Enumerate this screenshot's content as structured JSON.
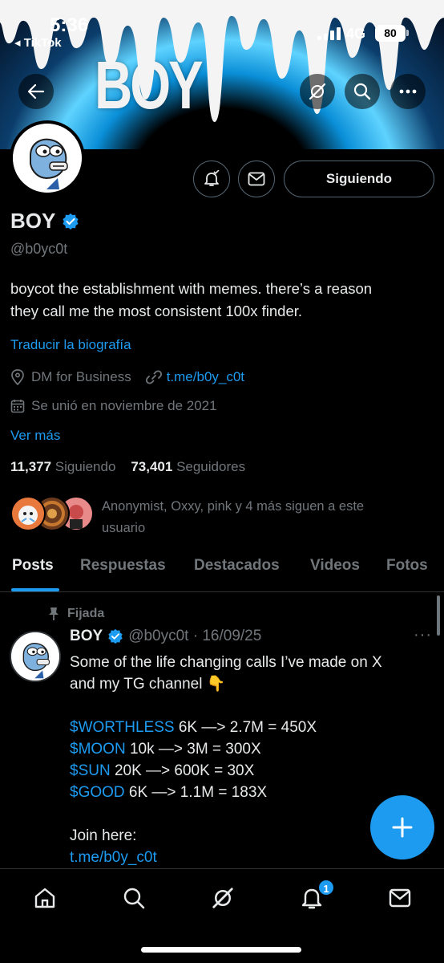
{
  "status_bar": {
    "time": "5:36",
    "back_app": "◂ TikTok",
    "network": "4G",
    "battery": "80"
  },
  "banner": {
    "title": "BOY"
  },
  "profile": {
    "name": "BOY",
    "handle": "@b0yc0t",
    "follow_label": "Siguiendo",
    "bio_line1": "boycot the establishment with memes. there’s a reason",
    "bio_line2": "they call me the most consistent 100x finder.",
    "translate_label": "Traducir la biografía",
    "location": "DM for Business",
    "link": "t.me/b0y_c0t",
    "joined": "Se unió en noviembre de 2021",
    "see_more": "Ver más",
    "following_count": "11,377",
    "following_label": "Siguiendo",
    "followers_count": "73,401",
    "followers_label": "Seguidores",
    "followed_by_line1": "Anonymist, Oxxy, pink y 4 más siguen a este",
    "followed_by_line2": "usuario"
  },
  "tabs": [
    {
      "label": "Posts"
    },
    {
      "label": "Respuestas"
    },
    {
      "label": "Destacados"
    },
    {
      "label": "Videos"
    },
    {
      "label": "Fotos"
    }
  ],
  "post": {
    "pinned_label": "Fijada",
    "name": "BOY",
    "handle_date": "@b0yc0t · 16/09/25",
    "more": "···",
    "line1": "Some of the life changing calls I’ve made on X",
    "line2": "and my TG channel 👇",
    "calls": [
      {
        "tag": "$WORTHLESS",
        "text": " 6K —> 2.7M = 450X"
      },
      {
        "tag": "$MOON",
        "text": " 10k —> 3M = 300X"
      },
      {
        "tag": "$SUN",
        "text": " 20K —> 600K = 30X"
      },
      {
        "tag": "$GOOD",
        "text": " 6K —> 1.1M = 183X"
      }
    ],
    "join": "Join here:",
    "join_link": "t.me/b0y_c0t"
  },
  "nav": {
    "notification_count": "1"
  },
  "colors": {
    "accent": "#1d9bf0",
    "background": "#000000",
    "muted": "#71767b"
  }
}
